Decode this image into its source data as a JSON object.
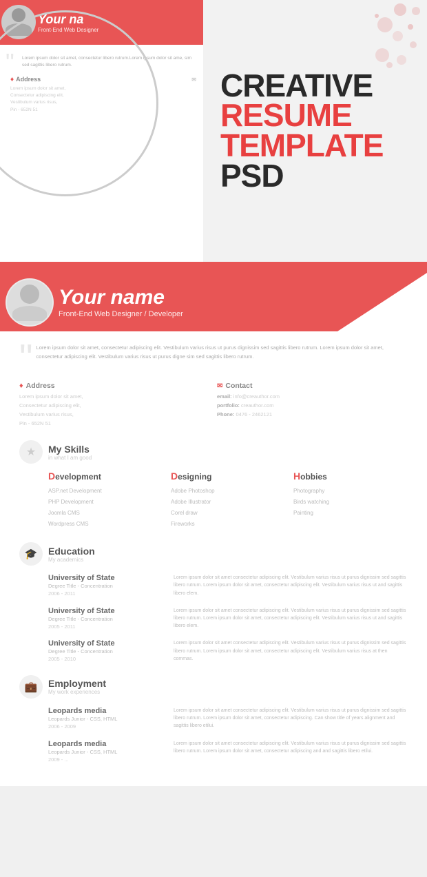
{
  "page": {
    "title": "Creative Resume Template PSD"
  },
  "preview": {
    "name": "Your na",
    "title": "Front-End Web Designer",
    "lorem_short": "Lorem ipsum dolor sit amet, consectetur libero rutrum.Lorem ipsum dolor sit ame, sim sed sagittis libero rutrum.",
    "address_label": "Address",
    "address_text": "Lorem ipsum dolor sit amet,\nConsectetur adipiscing elit,\nVestibulum varius risus,\nPin - 652N 51"
  },
  "creative_title": {
    "line1": "CREATIVE",
    "line2": "RESUME",
    "line3": "TEMPLATE",
    "line4": "PSD"
  },
  "resume": {
    "name": "Your name",
    "subtitle": "Front-End Web Designer / Developer",
    "quote_text": "Lorem ipsum dolor sit amet, consectetur adipiscing elit. Vestibulum varius risus ut purus dignissim sed sagittis libero rutrum. Lorem ipsum dolor sit amet, consectetur adipiscing elit. Vestibulum varius risus ut purus digne sim sed sagittis libero rutrum.",
    "address": {
      "label": "Address",
      "text": "Lorem ipsum dolor sit amet,\nConsectetur adipiscing elit,\nVestibulum varius risus,\nPin - 652N 51"
    },
    "contact": {
      "label": "Contact",
      "email_label": "email:",
      "email": "info@creauthor.com",
      "portfolio_label": "portfolio:",
      "portfolio": "creauthor.com",
      "phone_label": "Phone:",
      "phone": "0476 - 2462121"
    },
    "skills": {
      "section_title": "My Skills",
      "section_subtitle": "in what I am good",
      "categories": [
        {
          "title": "Development",
          "first_letter": "D",
          "items": [
            "ASP.net Development",
            "PHP Development",
            "Joomla CMS",
            "Wordpress CMS"
          ]
        },
        {
          "title": "Designing",
          "first_letter": "D",
          "items": [
            "Adobe Photoshop",
            "Adobe Illustrator",
            "Corel draw",
            "Fireworks"
          ]
        },
        {
          "title": "Hobbies",
          "first_letter": "H",
          "items": [
            "Photography",
            "Birds watching",
            "Painting"
          ]
        }
      ]
    },
    "education": {
      "section_title": "Education",
      "section_subtitle": "My academics",
      "entries": [
        {
          "school": "University of State",
          "degree": "Degree Title - Concentration",
          "years": "2006 - 2011",
          "description": "Lorem ipsum dolor sit amet consectetur adipiscing elit. Vestibulum varius risus ut purus dignissim sed sagittis libero rutrum. Lorem ipsum dolor sit amet, consectetur adipiscing elit. Vestibulum varius risus ut and sagittis libero elem."
        },
        {
          "school": "University of State",
          "degree": "Degree Title - Concentration",
          "years": "2005 - 2011",
          "description": "Lorem ipsum dolor sit amet consectetur adipiscing elit. Vestibulum varius risus ut purus dignissim sed sagittis libero rutrum. Lorem ipsum dolor sit amet, consectetur adipiscing elit. Vestibulum varius risus ut and sagittis libero elem."
        },
        {
          "school": "University of State",
          "degree": "Degree Title - Concentration",
          "years": "2005 - 2010",
          "description": "Lorem ipsum dolor sit amet consectetur adipiscing elit. Vestibulum varius risus ut purus dignissim sed sagittis libero rutrum. Lorem ipsum dolor sit amet, consectetur adipiscing elit. Vestibulum varius risus at then commas."
        }
      ]
    },
    "employment": {
      "section_title": "Employment",
      "section_subtitle": "My work experiences",
      "entries": [
        {
          "company": "Leopards media",
          "role": "Leopards Junior - CSS, HTML",
          "years": "2006 - 2009",
          "description": "Lorem ipsum dolor sit amet consectetur adipiscing elit. Vestibulum varius risus ut purus dignissim sed sagittis libero rutrum. Lorem ipsum dolor sit amet, consectetur adipiscing. Can show title of years alignment and sagittis libero etilui."
        },
        {
          "company": "Leopards media",
          "role": "Leopards Junior - CSS, HTML",
          "years": "2009 - ...",
          "description": "Lorem ipsum dolor sit amet consectetur adipiscing elit. Vestibulum varius risus ut purus dignissim sed sagittis libero rutrum. Lorem ipsum dolor sit amet, consectetur adipiscing and and sagittis libero etilui."
        }
      ]
    }
  }
}
